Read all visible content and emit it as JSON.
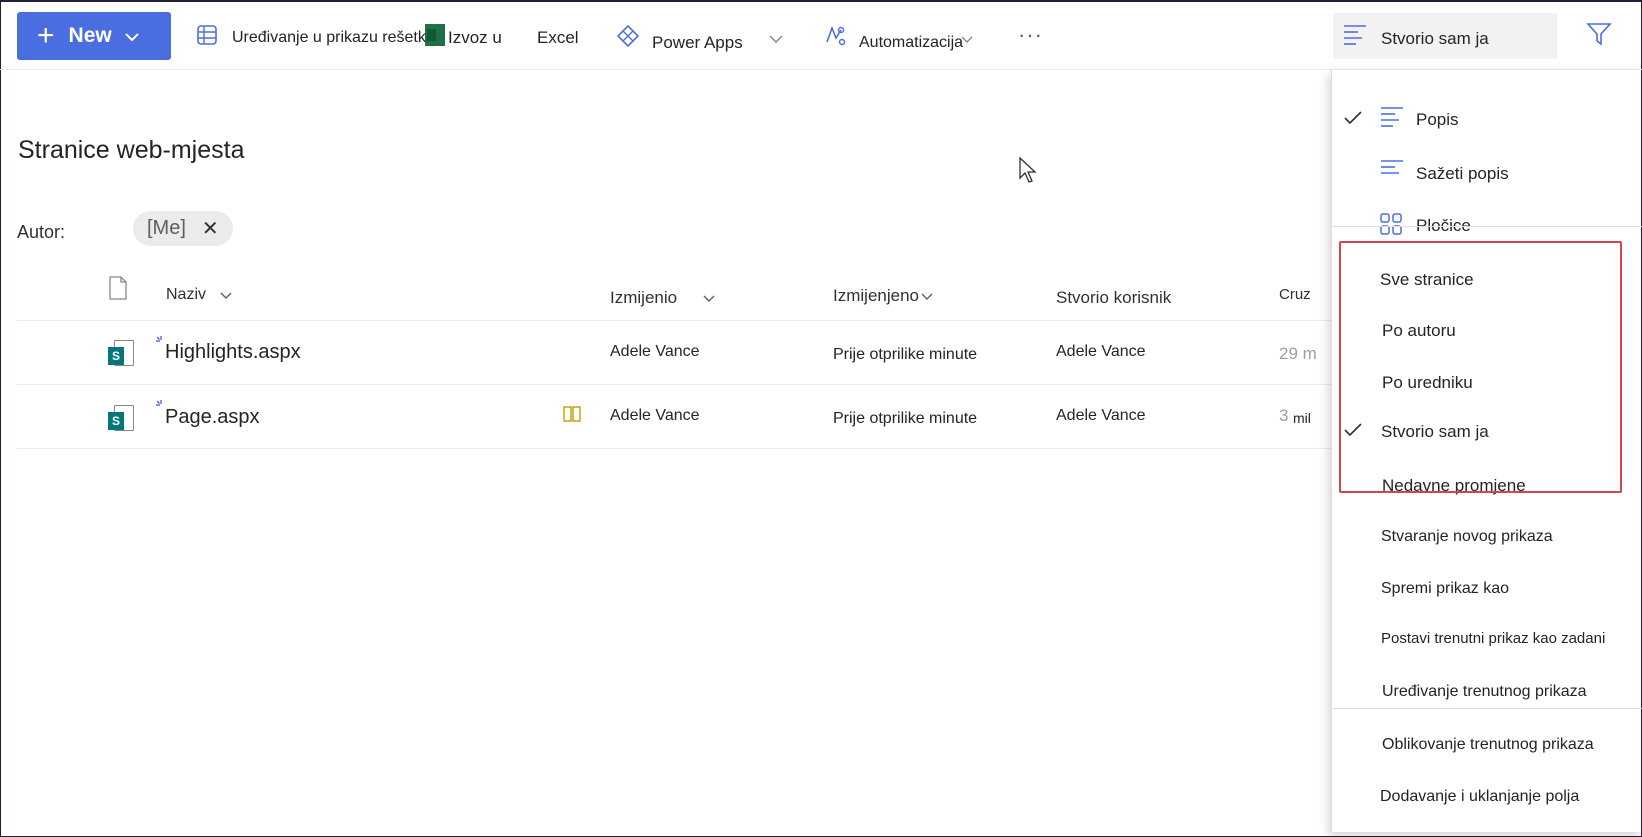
{
  "toolbar": {
    "new_label": "New",
    "grid_edit_label": "Uređivanje u prikazu rešetke",
    "export_label": "Izvoz u",
    "excel_label": "Excel",
    "power_apps_label": "Power Apps",
    "automation_label": "Automatizacija",
    "more_label": "···",
    "view_switch_label": "Stvorio sam ja"
  },
  "page": {
    "title": "Stranice web-mjesta",
    "filter_label": "Autor:",
    "filter_pill": "[Me]"
  },
  "columns": {
    "name": "Naziv",
    "modified_by": "Izmijenio",
    "modified": "Izmijenjeno",
    "created_by": "Stvorio korisnik",
    "truncated": "Cruz"
  },
  "rows": [
    {
      "name": "Highlights.aspx",
      "modified_by": "Adele Vance",
      "modified": "Prije otprilike minute",
      "created_by": "Adele Vance",
      "extra": "29 m"
    },
    {
      "name": "Page.aspx",
      "modified_by": "Adele Vance",
      "modified": "Prije otprilike minute",
      "created_by": "Adele Vance",
      "extra": "3",
      "extra2": "mil"
    }
  ],
  "dropdown": {
    "layouts": [
      "Popis",
      "Sažeti popis",
      "Pločice"
    ],
    "views": [
      "Sve stranice",
      "Po autoru",
      "Po uredniku",
      "Stvorio sam ja",
      "Nedavne promjene"
    ],
    "actions": [
      "Stvaranje novog prikaza",
      "Spremi prikaz kao",
      "Postavi trenutni prikaz kao zadani",
      "Uređivanje trenutnog prikaza"
    ],
    "format_actions": [
      "Oblikovanje trenutnog prikaza",
      "Dodavanje i uklanjanje polja"
    ]
  },
  "colors": {
    "accent": "#4a6ee0",
    "highlight_border": "#d9434f",
    "sharepoint_teal": "#03787c",
    "excel_green": "#1e7145"
  }
}
